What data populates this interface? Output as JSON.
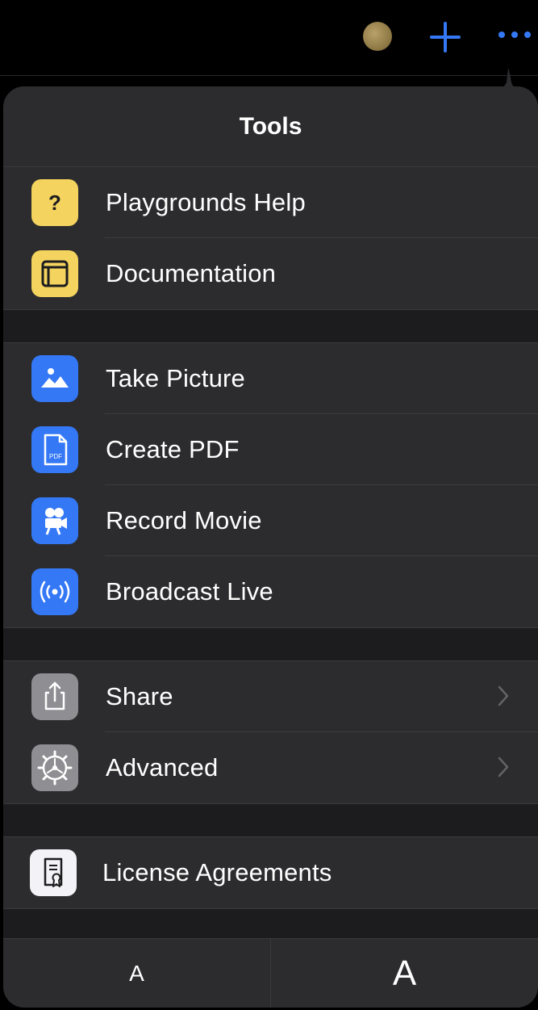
{
  "toolbar": {
    "avatar_icon": "avatar-circle",
    "add_icon": "plus-icon",
    "more_icon": "ellipsis-icon",
    "accent_color": "#3478f6"
  },
  "popover": {
    "title": "Tools",
    "groups": [
      {
        "items": [
          {
            "label": "Playgrounds Help",
            "icon": "question-mark-icon",
            "icon_color": "#f4d35e"
          },
          {
            "label": "Documentation",
            "icon": "book-icon",
            "icon_color": "#f4d35e"
          }
        ]
      },
      {
        "items": [
          {
            "label": "Take Picture",
            "icon": "photo-icon",
            "icon_color": "#3478f6"
          },
          {
            "label": "Create PDF",
            "icon": "pdf-icon",
            "icon_glyph": "PDF",
            "icon_color": "#3478f6"
          },
          {
            "label": "Record Movie",
            "icon": "movie-camera-icon",
            "icon_color": "#3478f6"
          },
          {
            "label": "Broadcast Live",
            "icon": "broadcast-icon",
            "icon_color": "#3478f6"
          }
        ]
      },
      {
        "items": [
          {
            "label": "Share",
            "icon": "share-icon",
            "icon_color": "#8e8e93",
            "chevron": "chevron-right-icon"
          },
          {
            "label": "Advanced",
            "icon": "gear-icon",
            "icon_color": "#8e8e93",
            "chevron": "chevron-right-icon"
          }
        ]
      },
      {
        "items": [
          {
            "label": "License Agreements",
            "icon": "certificate-icon",
            "icon_color": "#f2f2f7"
          }
        ]
      }
    ],
    "font_size": {
      "smaller_label": "A",
      "larger_label": "A"
    }
  }
}
